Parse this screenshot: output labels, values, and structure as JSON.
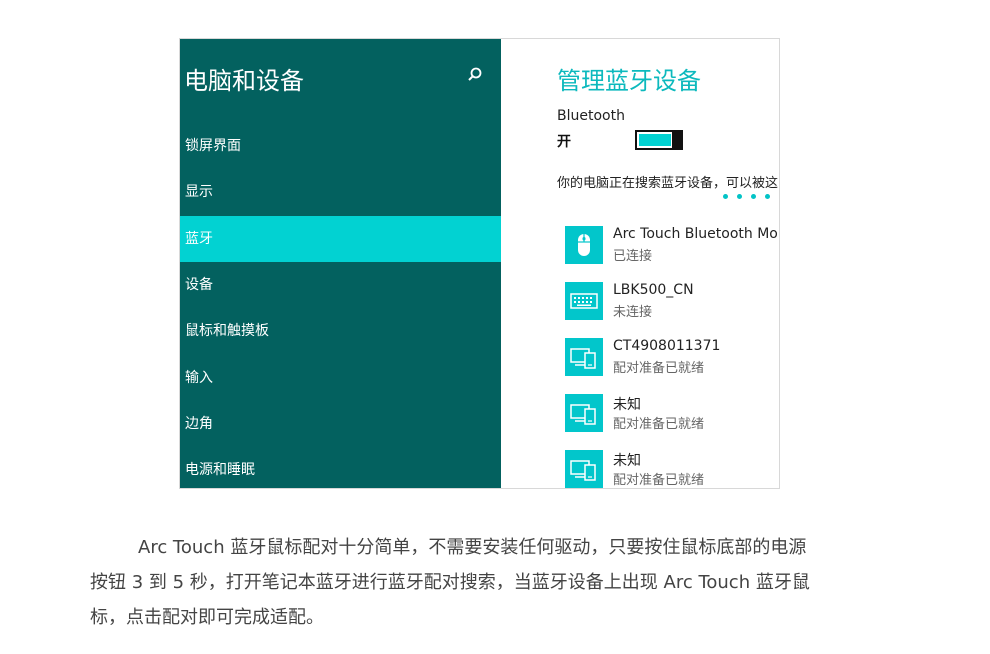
{
  "left": {
    "title": "电脑和设备",
    "nav": [
      {
        "label": "锁屏界面",
        "active": false
      },
      {
        "label": "显示",
        "active": false
      },
      {
        "label": "蓝牙",
        "active": true
      },
      {
        "label": "设备",
        "active": false
      },
      {
        "label": "鼠标和触摸板",
        "active": false
      },
      {
        "label": "输入",
        "active": false
      },
      {
        "label": "边角",
        "active": false
      },
      {
        "label": "电源和睡眠",
        "active": false
      }
    ]
  },
  "right": {
    "title": "管理蓝牙设备",
    "bluetooth_label": "Bluetooth",
    "bluetooth_state": "开",
    "searching_text": "你的电脑正在搜索蓝牙设备，可以被这",
    "devices": [
      {
        "name": "Arc Touch Bluetooth Mou",
        "status": "已连接",
        "icon": "mouse-icon"
      },
      {
        "name": "LBK500_CN",
        "status": "未连接",
        "icon": "keyboard-icon"
      },
      {
        "name": "CT4908011371",
        "status": "配对准备已就绪",
        "icon": "devices-icon"
      },
      {
        "name": "未知",
        "status": "配对准备已就绪",
        "icon": "devices-icon"
      },
      {
        "name": "未知",
        "status": "配对准备已就绪",
        "icon": "devices-icon"
      }
    ]
  },
  "caption": {
    "line1": "Arc Touch 蓝牙鼠标配对十分简单，不需要安装任何驱动，只要按住鼠标底部的电源",
    "line2": "按钮 3 到 5 秒，打开笔记本蓝牙进行蓝牙配对搜索，当蓝牙设备上出现 Arc Touch 蓝牙鼠",
    "line3": "标，点击配对即可完成适配。"
  },
  "colors": {
    "sidebar": "#03615f",
    "accent": "#02d2d2",
    "title": "#0cb9bd"
  }
}
